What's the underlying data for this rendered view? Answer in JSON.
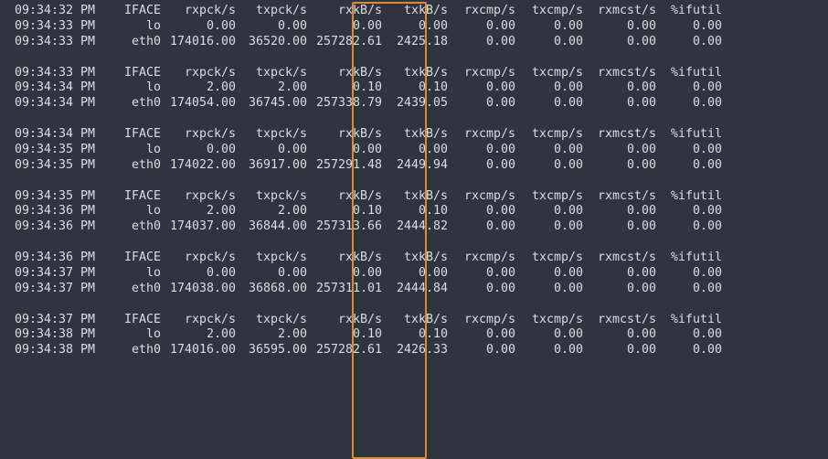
{
  "columns": {
    "time_label": "",
    "iface": "IFACE",
    "rxpck": "rxpck/s",
    "txpck": "txpck/s",
    "rxkb": "rxkB/s",
    "txkb": "txkB/s",
    "rxcmp": "rxcmp/s",
    "txcmp": "txcmp/s",
    "rxmcst": "rxmcst/s",
    "ifutil": "%ifutil"
  },
  "blocks": [
    {
      "header_time": "09:34:32 PM",
      "rows": [
        {
          "time": "09:34:33 PM",
          "iface": "lo",
          "rxpck": "0.00",
          "txpck": "0.00",
          "rxkb": "0.00",
          "txkb": "0.00",
          "rxcmp": "0.00",
          "txcmp": "0.00",
          "rxmcst": "0.00",
          "ifutil": "0.00"
        },
        {
          "time": "09:34:33 PM",
          "iface": "eth0",
          "rxpck": "174016.00",
          "txpck": "36520.00",
          "rxkb": "257282.61",
          "txkb": "2425.18",
          "rxcmp": "0.00",
          "txcmp": "0.00",
          "rxmcst": "0.00",
          "ifutil": "0.00"
        }
      ]
    },
    {
      "header_time": "09:34:33 PM",
      "rows": [
        {
          "time": "09:34:34 PM",
          "iface": "lo",
          "rxpck": "2.00",
          "txpck": "2.00",
          "rxkb": "0.10",
          "txkb": "0.10",
          "rxcmp": "0.00",
          "txcmp": "0.00",
          "rxmcst": "0.00",
          "ifutil": "0.00"
        },
        {
          "time": "09:34:34 PM",
          "iface": "eth0",
          "rxpck": "174054.00",
          "txpck": "36745.00",
          "rxkb": "257338.79",
          "txkb": "2439.05",
          "rxcmp": "0.00",
          "txcmp": "0.00",
          "rxmcst": "0.00",
          "ifutil": "0.00"
        }
      ]
    },
    {
      "header_time": "09:34:34 PM",
      "rows": [
        {
          "time": "09:34:35 PM",
          "iface": "lo",
          "rxpck": "0.00",
          "txpck": "0.00",
          "rxkb": "0.00",
          "txkb": "0.00",
          "rxcmp": "0.00",
          "txcmp": "0.00",
          "rxmcst": "0.00",
          "ifutil": "0.00"
        },
        {
          "time": "09:34:35 PM",
          "iface": "eth0",
          "rxpck": "174022.00",
          "txpck": "36917.00",
          "rxkb": "257291.48",
          "txkb": "2449.94",
          "rxcmp": "0.00",
          "txcmp": "0.00",
          "rxmcst": "0.00",
          "ifutil": "0.00"
        }
      ]
    },
    {
      "header_time": "09:34:35 PM",
      "rows": [
        {
          "time": "09:34:36 PM",
          "iface": "lo",
          "rxpck": "2.00",
          "txpck": "2.00",
          "rxkb": "0.10",
          "txkb": "0.10",
          "rxcmp": "0.00",
          "txcmp": "0.00",
          "rxmcst": "0.00",
          "ifutil": "0.00"
        },
        {
          "time": "09:34:36 PM",
          "iface": "eth0",
          "rxpck": "174037.00",
          "txpck": "36844.00",
          "rxkb": "257313.66",
          "txkb": "2444.82",
          "rxcmp": "0.00",
          "txcmp": "0.00",
          "rxmcst": "0.00",
          "ifutil": "0.00"
        }
      ]
    },
    {
      "header_time": "09:34:36 PM",
      "rows": [
        {
          "time": "09:34:37 PM",
          "iface": "lo",
          "rxpck": "0.00",
          "txpck": "0.00",
          "rxkb": "0.00",
          "txkb": "0.00",
          "rxcmp": "0.00",
          "txcmp": "0.00",
          "rxmcst": "0.00",
          "ifutil": "0.00"
        },
        {
          "time": "09:34:37 PM",
          "iface": "eth0",
          "rxpck": "174038.00",
          "txpck": "36868.00",
          "rxkb": "257311.01",
          "txkb": "2444.84",
          "rxcmp": "0.00",
          "txcmp": "0.00",
          "rxmcst": "0.00",
          "ifutil": "0.00"
        }
      ]
    },
    {
      "header_time": "09:34:37 PM",
      "rows": [
        {
          "time": "09:34:38 PM",
          "iface": "lo",
          "rxpck": "2.00",
          "txpck": "2.00",
          "rxkb": "0.10",
          "txkb": "0.10",
          "rxcmp": "0.00",
          "txcmp": "0.00",
          "rxmcst": "0.00",
          "ifutil": "0.00"
        },
        {
          "time": "09:34:38 PM",
          "iface": "eth0",
          "rxpck": "174016.00",
          "txpck": "36595.00",
          "rxkb": "257282.61",
          "txkb": "2426.33",
          "rxcmp": "0.00",
          "txcmp": "0.00",
          "rxmcst": "0.00",
          "ifutil": "0.00"
        }
      ]
    }
  ]
}
